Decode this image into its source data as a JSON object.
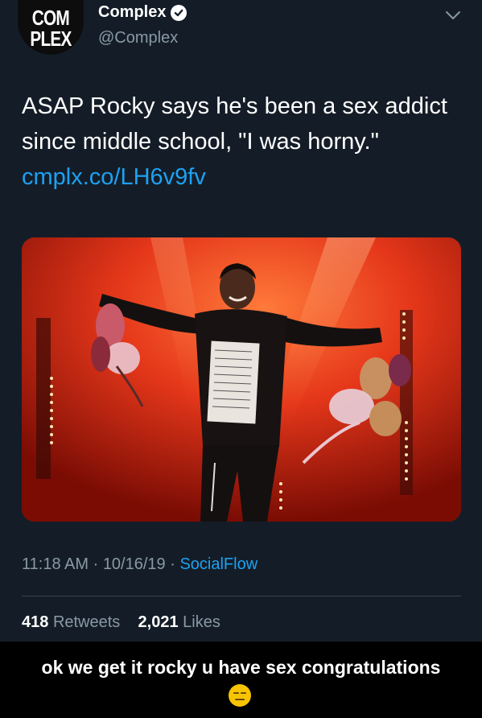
{
  "tweet": {
    "avatar_text": [
      "COM",
      "PLEX"
    ],
    "display_name": "Complex",
    "handle": "@Complex",
    "text": "ASAP Rocky says he's been a sex addict since middle school, \"I was horny.\"",
    "link": "cmplx.co/LH6v9fv",
    "time": "11:18 AM",
    "date": "10/16/19",
    "source": "SocialFlow",
    "retweets_count": "418",
    "retweets_label": "Retweets",
    "likes_count": "2,021",
    "likes_label": "Likes"
  },
  "caption": {
    "text": "ok we get it rocky u have sex congratulations",
    "emoji_icon": "expressionless-face-icon"
  },
  "colors": {
    "background": "#141d27",
    "link": "#1da1f2",
    "secondary_text": "#8899a6",
    "caption_background": "#000000"
  }
}
